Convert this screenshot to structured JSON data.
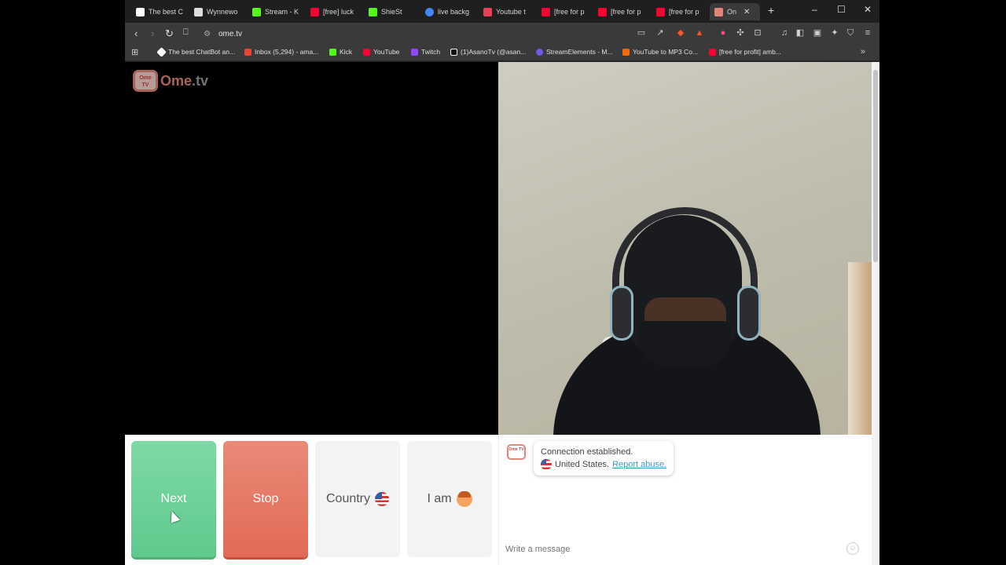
{
  "browser": {
    "tabs": [
      {
        "title": "The best C",
        "color": "#ffffff"
      },
      {
        "title": "Wynnewo",
        "color": "#ffffff"
      },
      {
        "title": "Stream - K",
        "color": "#53fc18"
      },
      {
        "title": "[free] luck",
        "color": "#ff0033"
      },
      {
        "title": "ShieSt",
        "color": "#53fc18"
      },
      {
        "title": "live backg",
        "color": "#4285f4"
      },
      {
        "title": "Youtube t",
        "color": "#e94057"
      },
      {
        "title": "[free for p",
        "color": "#ff0033"
      },
      {
        "title": "[free for p",
        "color": "#ff0033"
      },
      {
        "title": "[free for p",
        "color": "#ff0033"
      },
      {
        "title": "On",
        "color": "#e0857a"
      }
    ],
    "new_tab_label": "+",
    "controls": {
      "minimize": "–",
      "maximize": "☐",
      "close": "✕"
    },
    "url": "ome.tv",
    "bookmarks": [
      {
        "label": "The best ChatBot an...",
        "color": "#ffffff"
      },
      {
        "label": "Inbox (5,294) - ama...",
        "color": "#ea4335"
      },
      {
        "label": "Kick",
        "color": "#53fc18"
      },
      {
        "label": "YouTube",
        "color": "#ff0033"
      },
      {
        "label": "Twitch",
        "color": "#9146ff"
      },
      {
        "label": "(1)AsanoTv (@asan...",
        "color": "#ffffff"
      },
      {
        "label": "StreamElements - M...",
        "color": "#6c5ce7"
      },
      {
        "label": "YouTube to MP3 Co...",
        "color": "#ff6a00"
      },
      {
        "label": "[free for profit] amb...",
        "color": "#ff0033"
      }
    ],
    "more_bookmarks": "»"
  },
  "site": {
    "logo_icon_text": "Ome TV",
    "logo_text_main": "Ome",
    "logo_text_suffix": ".tv"
  },
  "controls": {
    "next_label": "Next",
    "stop_label": "Stop",
    "country_label": "Country",
    "iam_label": "I am"
  },
  "chat": {
    "status_line": "Connection established.",
    "country_line": "United States.",
    "report_label": "Report abuse.",
    "input_placeholder": "Write a message"
  },
  "colors": {
    "next_green": "#6dd19a",
    "stop_red": "#e5735f",
    "brand": "#e0857a",
    "link": "#3aa0b8"
  }
}
